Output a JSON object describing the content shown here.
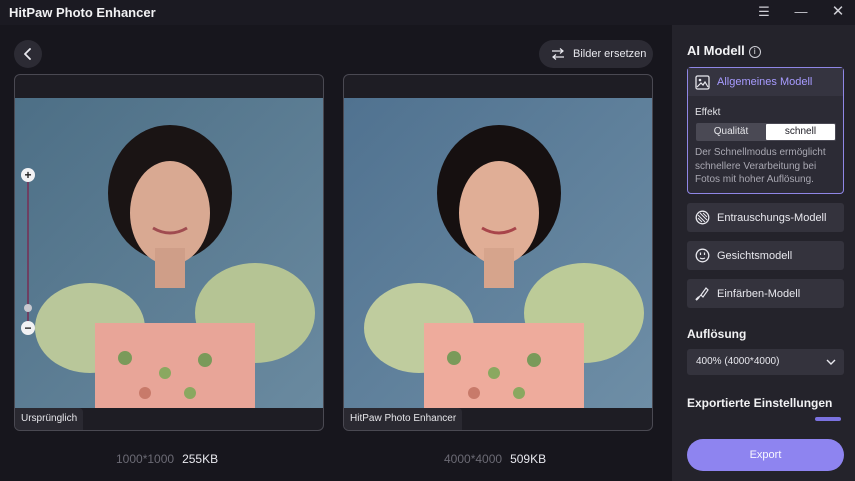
{
  "window": {
    "title": "HitPaw Photo Enhancer",
    "controls": {
      "menu": "☰",
      "minimize": "—",
      "close": "✕"
    }
  },
  "toolbar": {
    "replace_label": "Bilder ersetzen"
  },
  "panels": {
    "left": {
      "label": "Ursprünglich",
      "dimensions": "1000*1000",
      "size": "255KB"
    },
    "right": {
      "label": "HitPaw Photo Enhancer",
      "dimensions": "4000*4000",
      "size": "509KB"
    }
  },
  "zoom": {
    "plus": "+",
    "minus": "−",
    "level": 0.12
  },
  "sidebar": {
    "ai_model_title": "AI Modell",
    "info_glyph": "i",
    "selected_model": {
      "name": "Allgemeines Modell",
      "effect_label": "Effekt",
      "options": [
        "Qualität",
        "schnell"
      ],
      "selected_option": "schnell",
      "description": "Der Schnellmodus ermöglicht schnellere Verarbeitung bei Fotos mit hoher Auflösung."
    },
    "models": [
      {
        "name": "Entrauschungs-Modell",
        "icon": "denoise-icon"
      },
      {
        "name": "Gesichtsmodell",
        "icon": "face-icon"
      },
      {
        "name": "Einfärben-Modell",
        "icon": "colorize-icon"
      }
    ],
    "resolution_title": "Auflösung",
    "resolution_value": "400% (4000*4000)",
    "export_settings_title": "Exportierte Einstellungen",
    "export_label": "Export"
  },
  "colors": {
    "accent": "#8e84f0",
    "accent_text": "#a79bff",
    "background": "#16151c",
    "sidebar": "#24232b"
  }
}
